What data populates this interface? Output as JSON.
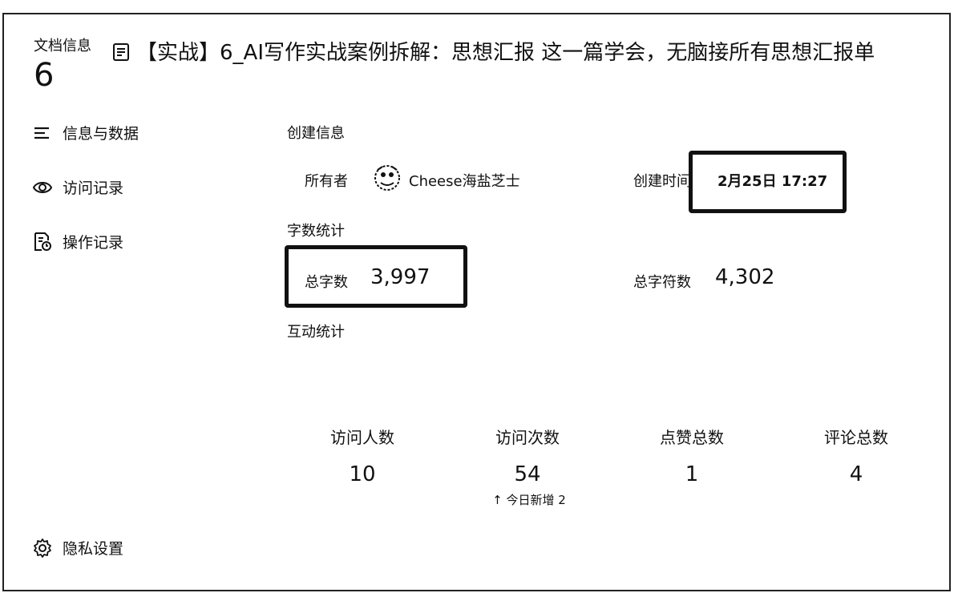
{
  "dialog": {
    "title": "文档信息",
    "number": "6"
  },
  "document": {
    "title": "【实战】6_AI写作实战案例拆解：思想汇报 这一篇学会，无脑接所有思想汇报单"
  },
  "sidebar": {
    "items": [
      {
        "label": "信息与数据",
        "icon": "list-icon"
      },
      {
        "label": "访问记录",
        "icon": "eye-icon"
      },
      {
        "label": "操作记录",
        "icon": "history-doc-icon"
      }
    ],
    "footer": {
      "label": "隐私设置",
      "icon": "gear-icon"
    }
  },
  "create_info": {
    "heading": "创建信息",
    "owner_label": "所有者",
    "owner_name": "Cheese海盐芝士",
    "created_label": "创建时间",
    "created_value": "2月25日 17:27"
  },
  "word_stats": {
    "heading": "字数统计",
    "total_words_label": "总字数",
    "total_words_value": "3,997",
    "total_chars_label": "总字符数",
    "total_chars_value": "4,302"
  },
  "interaction": {
    "heading": "互动统计",
    "stats": [
      {
        "label": "访问人数",
        "value": "10"
      },
      {
        "label": "访问次数",
        "value": "54"
      },
      {
        "label": "点赞总数",
        "value": "1"
      },
      {
        "label": "评论总数",
        "value": "4"
      }
    ],
    "visits_delta": "↑ 今日新增 2"
  }
}
